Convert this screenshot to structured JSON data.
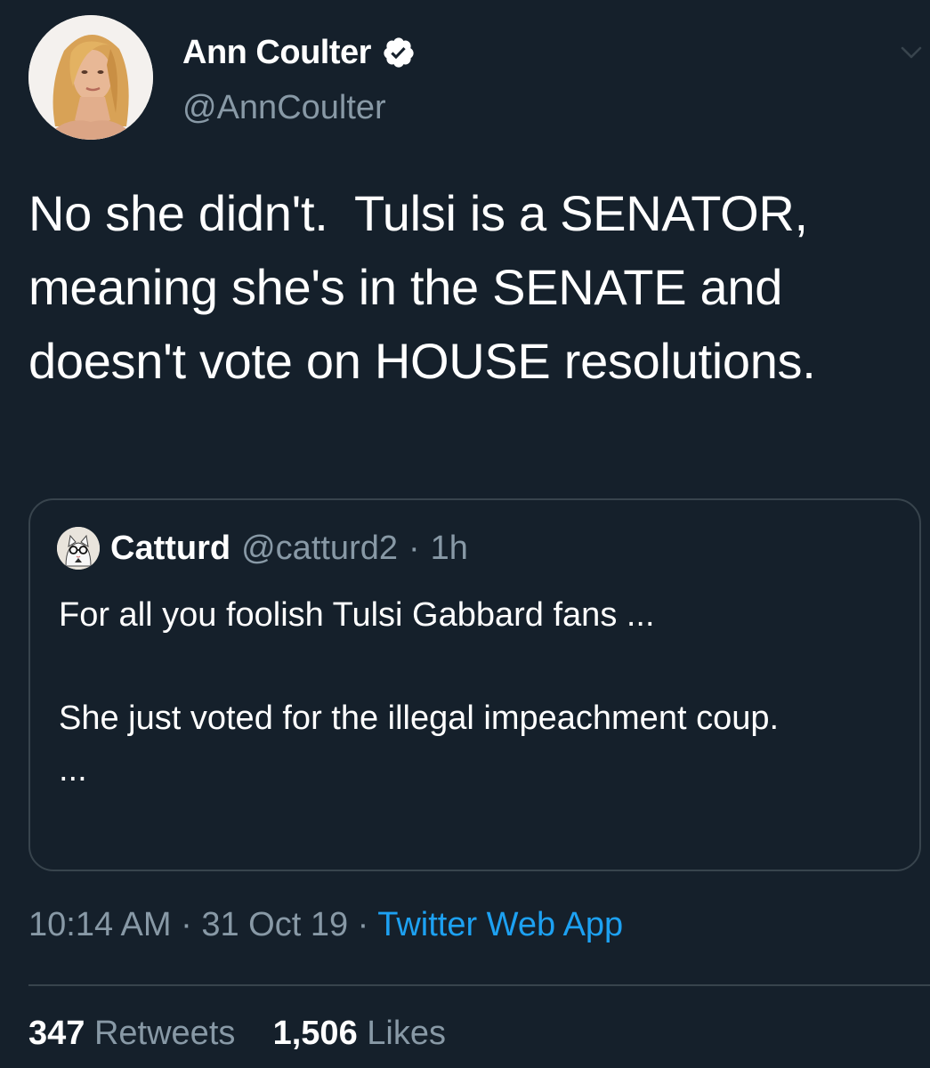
{
  "tweet": {
    "author": {
      "name": "Ann Coulter",
      "handle": "@AnnCoulter",
      "verified": true,
      "avatar_icon": "profile-photo"
    },
    "text": "No she didn't.  Tulsi is a SENATOR, meaning she's in the SENATE and doesn't vote on HOUSE resolutions.",
    "quoted": {
      "author_name": "Catturd",
      "author_handle": "@catturd2",
      "separator": "·",
      "time": "1h",
      "lines": [
        "For all you foolish Tulsi Gabbard fans ...",
        "She just voted for the illegal impeachment coup.",
        "..."
      ]
    },
    "meta": {
      "time": "10:14 AM",
      "separator": "·",
      "date": "31 Oct 19",
      "source": "Twitter Web App"
    },
    "stats": {
      "retweets_count": "347",
      "retweets_label": "Retweets",
      "likes_count": "1,506",
      "likes_label": "Likes"
    }
  },
  "colors": {
    "background": "#15202b",
    "text_primary": "#ffffff",
    "text_secondary": "#8899a6",
    "link": "#1da1f2",
    "border": "#38444d"
  }
}
